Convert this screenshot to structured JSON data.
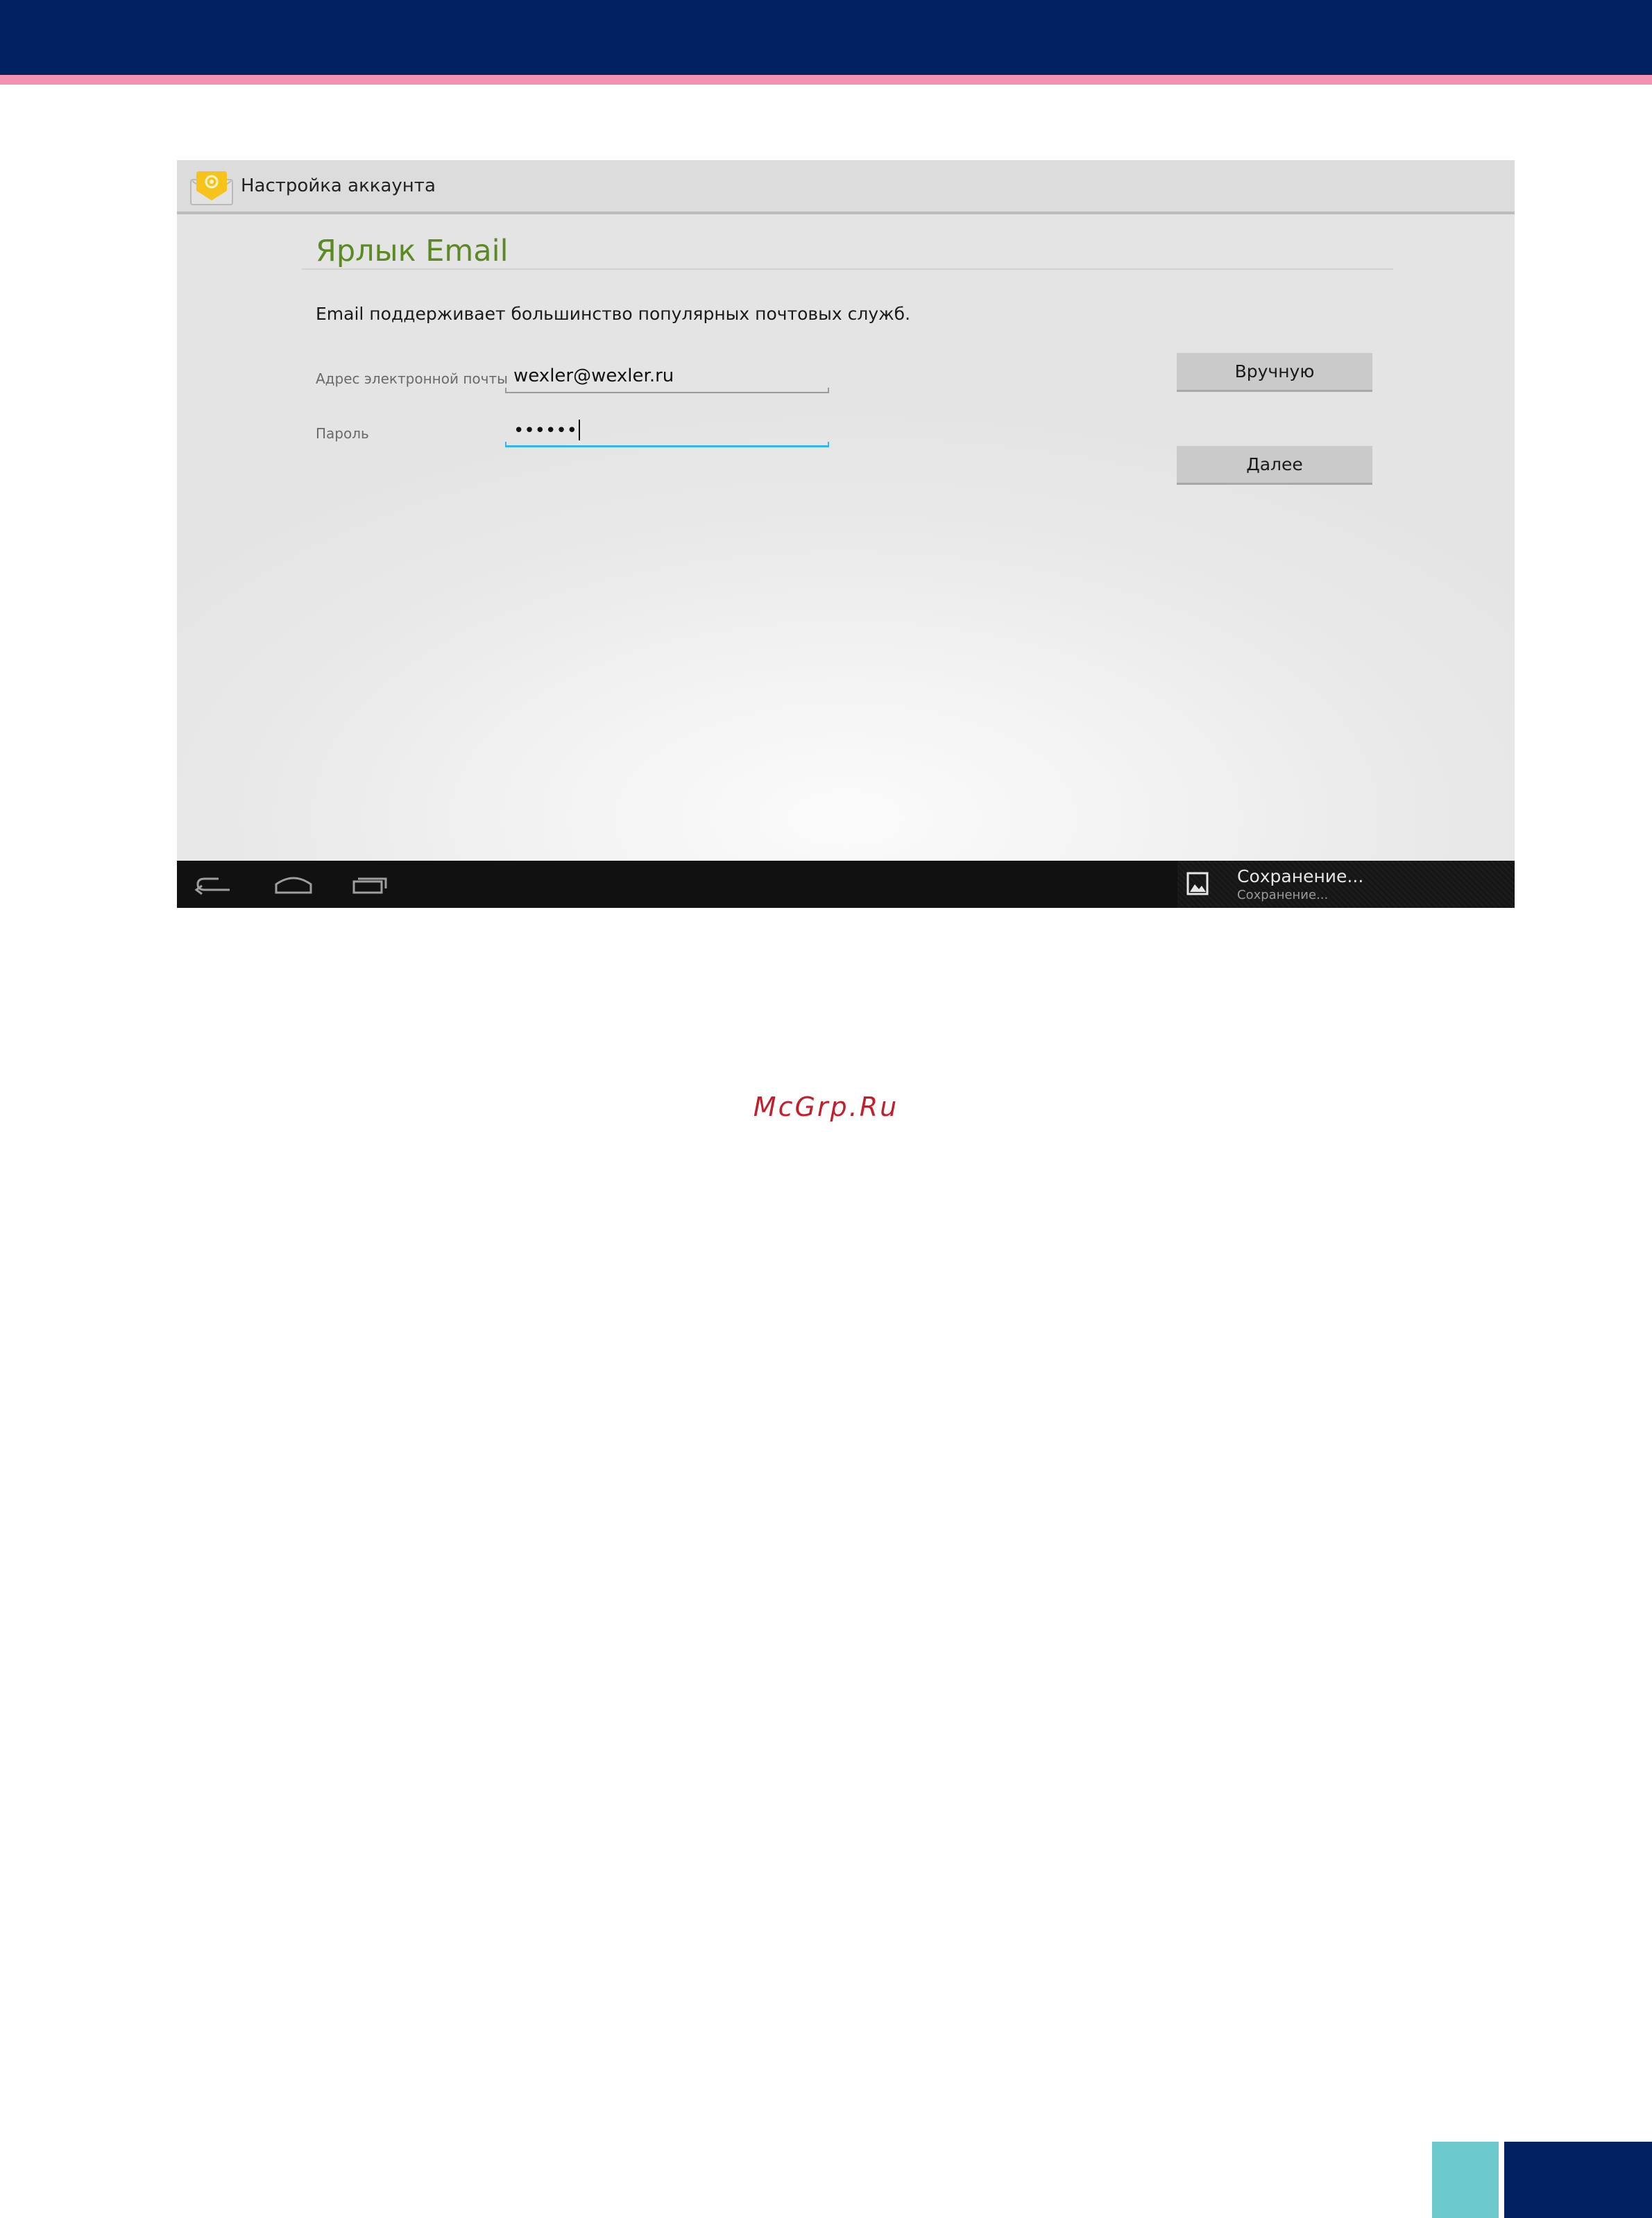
{
  "app_bar": {
    "title": "Настройка аккаунта"
  },
  "form": {
    "section_title": "Ярлык Email",
    "intro": "Email поддерживает большинство популярных почтовых служб.",
    "email": {
      "label": "Адрес электронной почты",
      "value": "wexler@wexler.ru"
    },
    "password": {
      "label": "Пароль",
      "value": "••••••"
    }
  },
  "buttons": {
    "manual": "Вручную",
    "next": "Далее"
  },
  "notification": {
    "title": "Сохранение...",
    "subtitle": "Сохранение..."
  },
  "nav_icons": [
    "back-icon",
    "home-icon",
    "recent-apps-icon"
  ],
  "watermark": "McGrp.Ru",
  "colors": {
    "header_navy": "#002060",
    "pink_stripe": "#f391b2",
    "accent_green": "#5b8a22",
    "focus_blue": "#33b5e5",
    "teal": "#6cc9cd"
  }
}
